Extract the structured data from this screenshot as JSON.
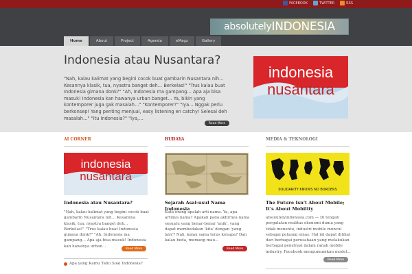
{
  "topbar": {
    "social": [
      {
        "label": "FACEBOOK",
        "icon": "facebook-icon"
      },
      {
        "label": "TWITTER",
        "icon": "twitter-icon"
      },
      {
        "label": "RSS",
        "icon": "rss-icon"
      }
    ]
  },
  "header": {
    "logo_prefix": "absolutely",
    "logo_main": "INDONESIA"
  },
  "nav": {
    "tabs": [
      {
        "label": "Home",
        "active": true
      },
      {
        "label": "About"
      },
      {
        "label": "Project"
      },
      {
        "label": "Agenda"
      },
      {
        "label": "eMagz"
      },
      {
        "label": "Gallery"
      }
    ]
  },
  "feature": {
    "title": "Indonesia atau Nusantara?",
    "text": "\"Nah, kalau kalimat yang begini cocok buat gambarin Nusantara nih… Kesannya klasik, tua, nyastra banget deh… Berkelas!\" \"Trus kalau buat Indonesia gimana donk?\" \"Ah, Indonesia ma gampang… Apa aja bisa masuk! Indonesia kan hawanya urban banget… Ya, bikin yang kontemporer juga gak masalah…\" \"Kontemporer?\" \"Iya… Nggak perlu berkonsep! Yang penting menjual, easy listening en catchy! Selesai deh masalah…\" \"Itu Indonesia?\" \"Iya,…",
    "image_line1": "indonesia",
    "image_line2": "nusantara",
    "read_more": "Read More"
  },
  "columns": [
    {
      "heading": "AI CORNER",
      "image_line1": "indonesia",
      "image_line2": "nusantara",
      "title": "Indonesia atau Nusantara?",
      "text": "\"Nah, kalau kalimat yang begini cocok buat gambarin Nusantara nih… Kesannya klasik, tua, nyastra banget deh… Berkelas!\" \"Trus kalau buat Indonesia gimana donk?\" \"Ah, Indonesia ma gampang… Apa aja bisa masuk! Indonesia kan hawanya urban…",
      "read_more": "Read More"
    },
    {
      "heading": "BUDAYA",
      "title": "Sejarah Asal-usul Nama Indonesia",
      "text": "Kata orang apalah arti nama. Ya, apa artinya nama? Apakah pada akhirnya nama sesuatu yang benar-benar 'unik', yang dapat membedakan 'kita' dengan 'yang lain'? Nah, kalau sama terus kenapa? Dan kalau beda, memang mau…",
      "read_more": "Read More"
    },
    {
      "heading": "MEDIA & TEKNOLOGI",
      "image_caption": "SOLIDARITY KNOWS NO BORDERS",
      "title": "The Future Isn't About Mobile; It's About Mobility",
      "text": "absolutelyindonesia.com — Di tengah pergulatan realitas ekonomi dunia yang tidak menentu, industri mobile muncul sebagai peluang emas. Hal ini dapat dilihat dari berbagai perusahaan yang melakukan berbagai penetrasi dalam ranah mobile industry. Facebook mengumumkan model…",
      "read_more": "Read More"
    }
  ],
  "more_list": {
    "first_item": "Apa yang Kamu Tahu Soal Indonesia?"
  }
}
